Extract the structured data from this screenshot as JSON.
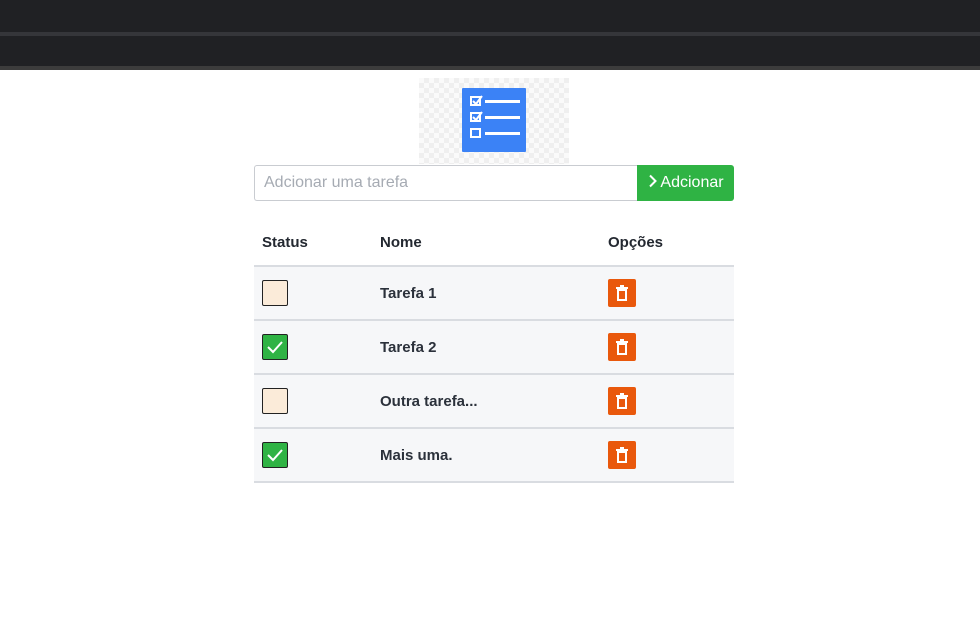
{
  "form": {
    "placeholder": "Adcionar uma tarefa",
    "value": "",
    "add_button_label": "Adcionar"
  },
  "table": {
    "headers": {
      "status": "Status",
      "name": "Nome",
      "options": "Opções"
    },
    "rows": [
      {
        "name": "Tarefa 1",
        "done": false
      },
      {
        "name": "Tarefa 2",
        "done": true
      },
      {
        "name": "Outra tarefa...",
        "done": false
      },
      {
        "name": "Mais uma.",
        "done": true
      }
    ]
  },
  "icons": {
    "logo": "checklist-icon",
    "add": "chevron-right-icon",
    "delete": "trash-icon",
    "check": "checkmark-icon"
  },
  "colors": {
    "browser_chrome": "#202124",
    "primary_logo": "#3b82f6",
    "add_button": "#2fb344",
    "delete_button": "#e9580c",
    "checked_box": "#2fb344",
    "unchecked_box": "#fbebd9",
    "row_background": "#f6f7f9"
  }
}
